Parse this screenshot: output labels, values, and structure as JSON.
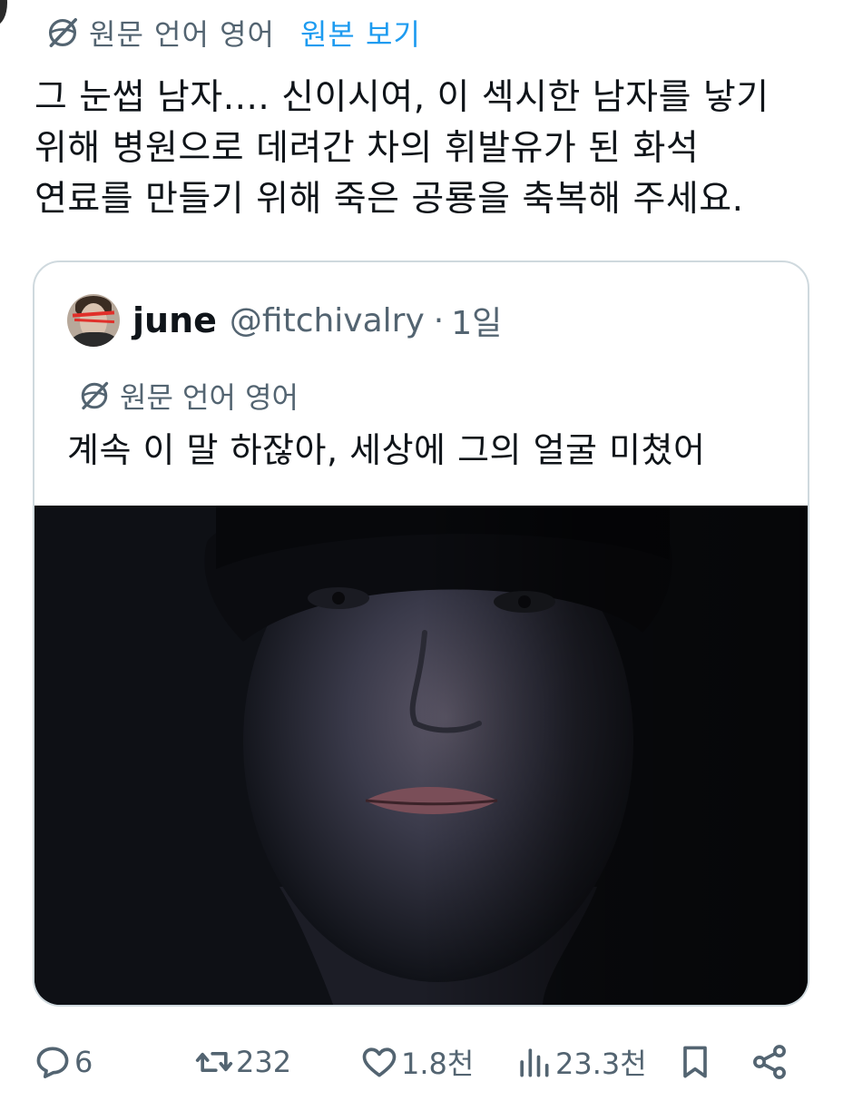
{
  "translation_bar": {
    "source_label": "원문 언어 영어",
    "view_original_label": "원본 보기"
  },
  "tweet": {
    "lines": [
      "그 눈썹 남자.... 신이시여, 이 섹시한 남자를 낳기",
      "위해 병원으로 데려간 차의 휘발유가 된 화석",
      "연료를 만들기 위해 죽은 공룡을 축복해 주세요."
    ]
  },
  "quote": {
    "name": "june",
    "handle": "@fitchivalry",
    "separator": "·",
    "time": "1일",
    "translation_label": "원문 언어 영어",
    "text": "계속 이 말 하잖아, 세상에 그의 얼굴 미쳤어"
  },
  "actions": {
    "reply_count": "6",
    "retweet_count": "232",
    "like_count": "1.8천",
    "views_count": "23.3천"
  },
  "icons": {
    "globe": "globe-slash-icon",
    "reply": "speech-bubble-icon",
    "retweet": "retweet-icon",
    "like": "heart-icon",
    "views": "bar-chart-icon",
    "bookmark": "bookmark-icon",
    "share": "share-icon"
  },
  "colors": {
    "accent": "#1d9bf0",
    "secondary_text": "#536471",
    "primary_text": "#0f1419",
    "card_border": "#cfd9de"
  }
}
